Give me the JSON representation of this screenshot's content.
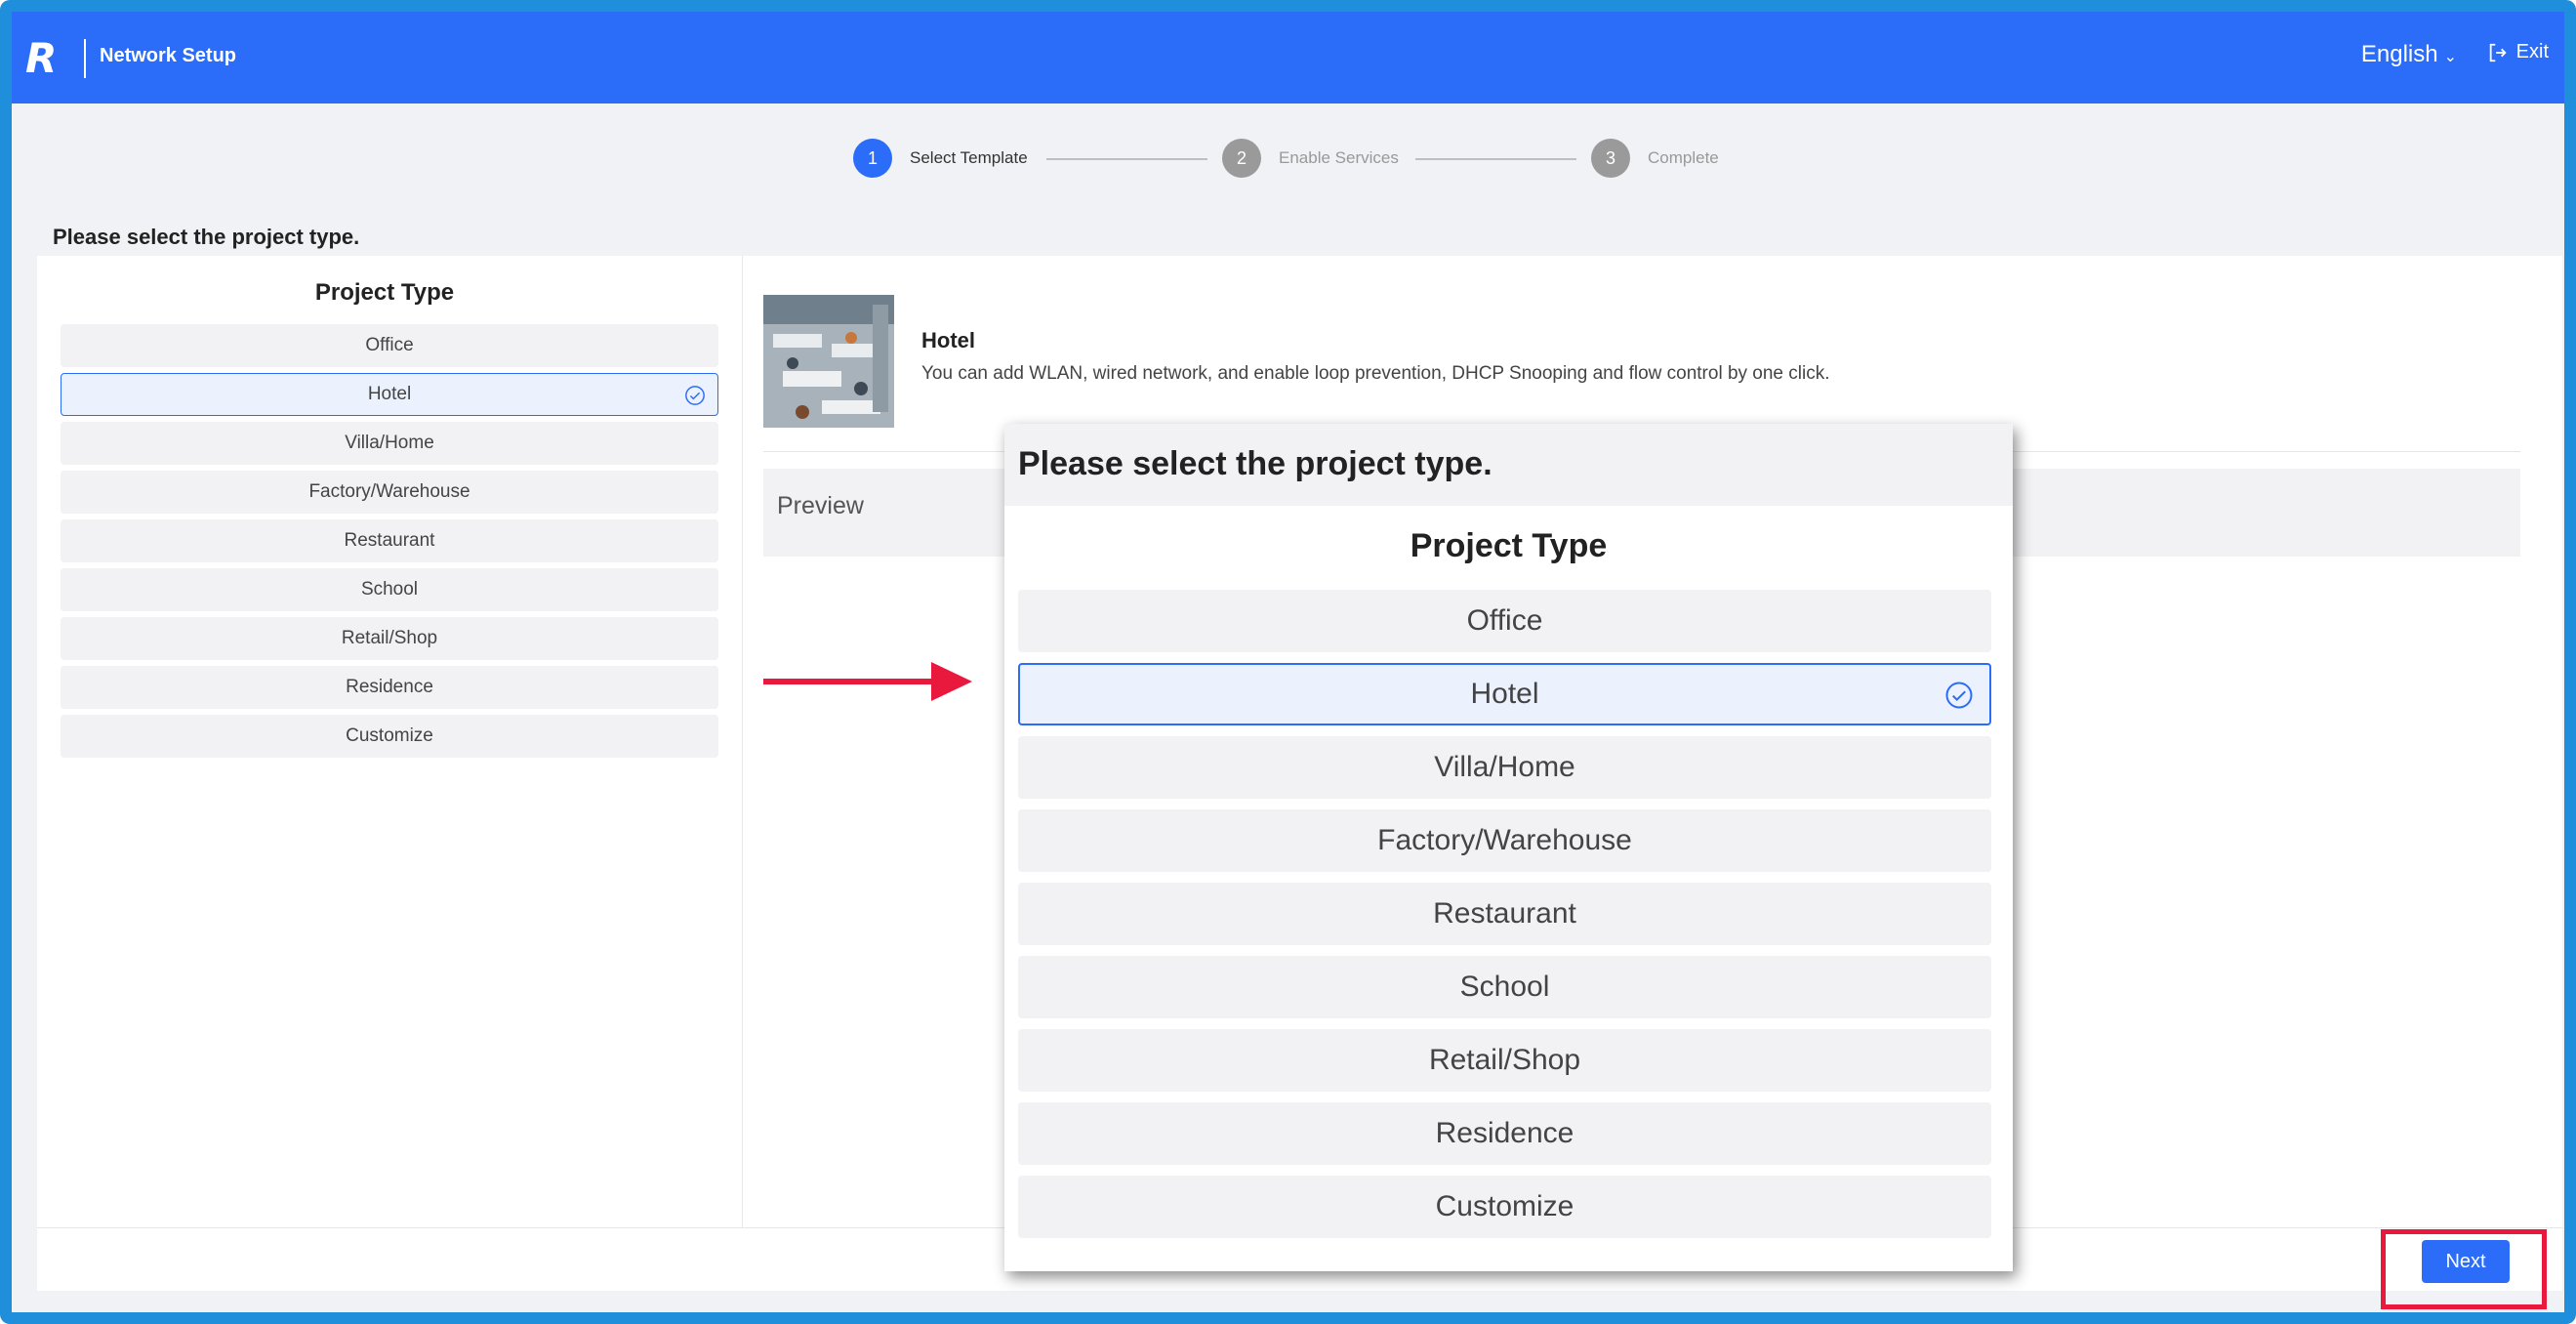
{
  "header": {
    "app_title": "Network Setup",
    "language": "English",
    "exit_label": "Exit"
  },
  "steps": [
    {
      "number": "1",
      "label": "Select Template",
      "state": "active"
    },
    {
      "number": "2",
      "label": "Enable Services",
      "state": "pending"
    },
    {
      "number": "3",
      "label": "Complete",
      "state": "pending"
    }
  ],
  "prompt": "Please select the project type.",
  "project_type": {
    "title": "Project Type",
    "options": [
      "Office",
      "Hotel",
      "Villa/Home",
      "Factory/Warehouse",
      "Restaurant",
      "School",
      "Retail/Shop",
      "Residence",
      "Customize"
    ],
    "selected": "Hotel"
  },
  "detail": {
    "title": "Hotel",
    "description": "You can add WLAN, wired network, and enable loop prevention, DHCP Snooping and flow control by one click.",
    "preview_label": "Preview"
  },
  "footer": {
    "next_label": "Next"
  },
  "colors": {
    "primary": "#2b6cf8",
    "highlight": "#e8193c",
    "frame": "#1f8fdb"
  },
  "icons": [
    "brand-logo-icon",
    "chevron-down-icon",
    "exit-icon",
    "check-circle-icon",
    "red-arrow-icon"
  ]
}
